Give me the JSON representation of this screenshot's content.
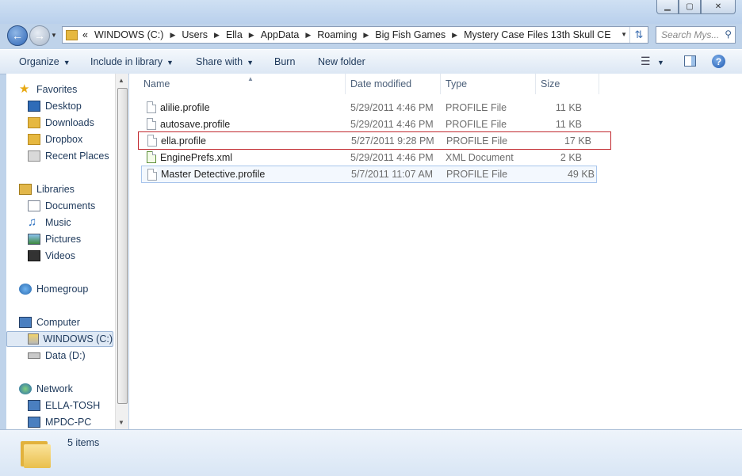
{
  "window": {
    "minimize_glyph": "▁",
    "maximize_glyph": "▢",
    "close_glyph": "✕"
  },
  "address": {
    "overflow": "«",
    "crumbs": [
      "WINDOWS (C:)",
      "Users",
      "Ella",
      "AppData",
      "Roaming",
      "Big Fish Games",
      "Mystery Case Files 13th Skull CE"
    ],
    "search_placeholder": "Search Mys..."
  },
  "toolbar": {
    "organize": "Organize",
    "include_in_library": "Include in library",
    "share_with": "Share with",
    "burn": "Burn",
    "new_folder": "New folder"
  },
  "nav": {
    "favorites": "Favorites",
    "desktop": "Desktop",
    "downloads": "Downloads",
    "dropbox": "Dropbox",
    "recent_places": "Recent Places",
    "libraries": "Libraries",
    "documents": "Documents",
    "music": "Music",
    "pictures": "Pictures",
    "videos": "Videos",
    "homegroup": "Homegroup",
    "computer": "Computer",
    "windows_c": "WINDOWS (C:)",
    "data_d": "Data (D:)",
    "network": "Network",
    "ella_tosh": "ELLA-TOSH",
    "mpdc_pc": "MPDC-PC"
  },
  "columns": {
    "name": "Name",
    "date_modified": "Date modified",
    "type": "Type",
    "size": "Size"
  },
  "files": [
    {
      "name": "alilie.profile",
      "date": "5/29/2011 4:46 PM",
      "type": "PROFILE File",
      "size": "11 KB"
    },
    {
      "name": "autosave.profile",
      "date": "5/29/2011 4:46 PM",
      "type": "PROFILE File",
      "size": "11 KB"
    },
    {
      "name": "ella.profile",
      "date": "5/27/2011 9:28 PM",
      "type": "PROFILE File",
      "size": "17 KB"
    },
    {
      "name": "EnginePrefs.xml",
      "date": "5/29/2011 4:46 PM",
      "type": "XML Document",
      "size": "2 KB"
    },
    {
      "name": "Master Detective.profile",
      "date": "5/7/2011 11:07 AM",
      "type": "PROFILE File",
      "size": "49 KB"
    }
  ],
  "status": {
    "item_count": "5 items"
  },
  "colors": {
    "highlight_border": "#c1272d",
    "selection_border": "#a8c5ec"
  }
}
